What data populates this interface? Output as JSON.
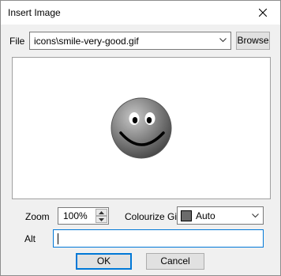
{
  "window": {
    "title": "Insert Image"
  },
  "file": {
    "label": "File",
    "value": "icons\\smile-very-good.gif",
    "browse_label": "Browse"
  },
  "preview": {
    "image_icon": "smiley-face-icon"
  },
  "zoom": {
    "label": "Zoom",
    "value": "100%"
  },
  "colorize": {
    "label": "Colourize Gif",
    "value": "Auto",
    "swatch_color": "#6b6b6b"
  },
  "alt": {
    "label": "Alt",
    "value": ""
  },
  "buttons": {
    "ok": "OK",
    "cancel": "Cancel"
  }
}
